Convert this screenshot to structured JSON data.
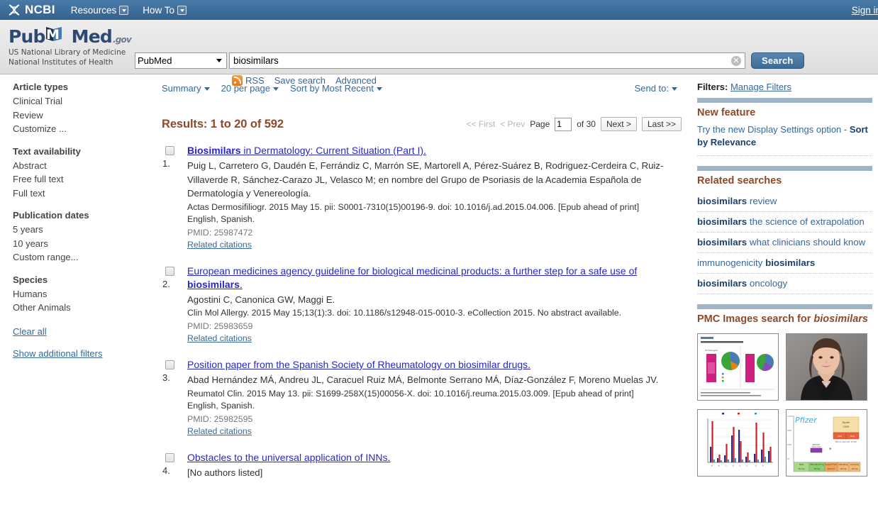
{
  "ncbi_bar": {
    "logo_text": "NCBI",
    "menus": [
      {
        "label": "Resources",
        "icon": "chevron-down-box-icon"
      },
      {
        "label": "How To",
        "icon": "chevron-down-box-icon"
      }
    ],
    "signin_label": "Sign in"
  },
  "pubmed_header": {
    "wordmark_pub": "Pub",
    "wordmark_med": "Med",
    "wordmark_gov": ".gov",
    "tagline_line1": "US National Library of Medicine",
    "tagline_line2": "National Institutes of Health",
    "database_selected": "PubMed",
    "database_options": [
      "PubMed"
    ],
    "search_value": "biosimilars",
    "search_placeholder": "",
    "search_button_label": "Search",
    "clear_icon_glyph": "✕",
    "sub_links": [
      {
        "label": "RSS",
        "icon": "rss-icon"
      },
      {
        "label": "Save search",
        "icon": ""
      },
      {
        "label": "Advanced",
        "icon": ""
      }
    ]
  },
  "left_sidebar": {
    "groups": [
      {
        "heading": "Article types",
        "items": [
          "Clinical Trial",
          "Review",
          "Customize ..."
        ]
      },
      {
        "heading": "Text availability",
        "items": [
          "Abstract",
          "Free full text",
          "Full text"
        ]
      },
      {
        "heading": "Publication dates",
        "items": [
          "5 years",
          "10 years",
          "Custom range..."
        ]
      },
      {
        "heading": "Species",
        "items": [
          "Humans",
          "Other Animals"
        ]
      }
    ],
    "clear_all": "Clear all",
    "show_additional": "Show additional filters"
  },
  "display_bar": {
    "format": "Summary",
    "per_page": "20 per page",
    "sort": "Sort by Most Recent",
    "send_to": "Send to:"
  },
  "results": {
    "count_text": "Results: 1 to 20 of 592",
    "pager": {
      "first": "<< First",
      "prev": "< Prev",
      "page_label": "Page",
      "page_value": "1",
      "of_label": "of 30",
      "next": "Next >",
      "last": "Last >>"
    },
    "items": [
      {
        "number": "1.",
        "title_bold": "Biosimilars",
        "title_rest": " in Dermatology: Current Situation (Part I).",
        "authors": "Puig L, Carretero G, Daudén E, Ferrándiz C, Marrón SE, Martorell A, Pérez-Suárez B, Rodriguez-Cerdeira C, Ruiz-Villaverde R, Sánchez-Carazo JL, Velasco M; en nombre del Grupo de Psoriasis de la Academia Española de Dermatología y Venereología.",
        "journal": "Actas Dermosifiliogr. 2015 May 15. pii: S0001-7310(15)00196-9. doi: 10.1016/j.ad.2015.04.006. [Epub ahead of print]",
        "language": "English, Spanish.",
        "pmid": "PMID: 25987472",
        "related": "Related citations"
      },
      {
        "number": "2.",
        "title_bold": "",
        "title_prefix": "European medicines agency guideline for biological medicinal products: a further step for a safe use of ",
        "title_rest": ".",
        "title_highlight": "biosimilars",
        "authors": "Agostini C, Canonica GW, Maggi E.",
        "journal": "Clin Mol Allergy. 2015 May 15;13(1):3. doi: 10.1186/s12948-015-0010-3. eCollection 2015. No abstract available.",
        "language": "",
        "pmid": "PMID: 25983659",
        "related": "Related citations"
      },
      {
        "number": "3.",
        "title_bold": "",
        "title_prefix": "Position paper from the Spanish Society of Rheumatology on biosimilar drugs.",
        "title_rest": "",
        "title_highlight": "",
        "authors": "Abad Hernández MÁ, Andreu JL, Caracuel Ruiz MÁ, Belmonte Serrano MÁ, Díaz-González F, Moreno Muelas JV.",
        "journal": "Reumatol Clin. 2015 May 13. pii: S1699-258X(15)00056-X. doi: 10.1016/j.reuma.2015.03.009. [Epub ahead of print]",
        "language": "English, Spanish.",
        "pmid": "PMID: 25982595",
        "related": "Related citations"
      },
      {
        "number": "4.",
        "title_bold": "",
        "title_prefix": "Obstacles to the universal application of INNs.",
        "title_rest": "",
        "title_highlight": "",
        "authors": "[No authors listed]",
        "journal": "",
        "language": "",
        "pmid": "",
        "related": ""
      }
    ]
  },
  "right_sidebar": {
    "filters_label": "Filters:",
    "manage_filters": "Manage Filters",
    "new_feature": {
      "title": "New feature",
      "text_plain": "Try the new Display Settings option - ",
      "text_bold": "Sort by Relevance"
    },
    "related_searches": {
      "title": "Related searches",
      "items": [
        {
          "bold": "biosimilars",
          "plain": " review",
          "bold_first": true
        },
        {
          "bold": "biosimilars",
          "plain": " the science of extrapolation",
          "bold_first": true
        },
        {
          "bold": "biosimilars",
          "plain": " what clinicians should know",
          "bold_first": true
        },
        {
          "bold": "biosimilars",
          "plain": "immunogenicity ",
          "bold_first": false
        },
        {
          "bold": "biosimilars",
          "plain": " oncology",
          "bold_first": true
        }
      ]
    },
    "pmc_images": {
      "title_plain": "PMC Images search for ",
      "title_italic": "biosimilars",
      "thumbnails": [
        {
          "name": "thumb-pie-bar-chart",
          "alt": "global spending bar and pie chart figure"
        },
        {
          "name": "thumb-portrait-photo",
          "alt": "portrait photograph of a woman"
        },
        {
          "name": "thumb-grouped-bar-chart",
          "alt": "grouped red and blue bar chart"
        },
        {
          "name": "thumb-pfizer-diagram",
          "alt": "Pfizer timeline matrix diagram"
        }
      ]
    }
  },
  "colors": {
    "ncbi_blue": "#3a6a9a",
    "link_blue": "#36689c",
    "title_link": "#2727c8",
    "accent_brown": "#8c4a2a",
    "portlet_bar": "#9fb4c7",
    "header_gray": "#e8e8e8"
  }
}
